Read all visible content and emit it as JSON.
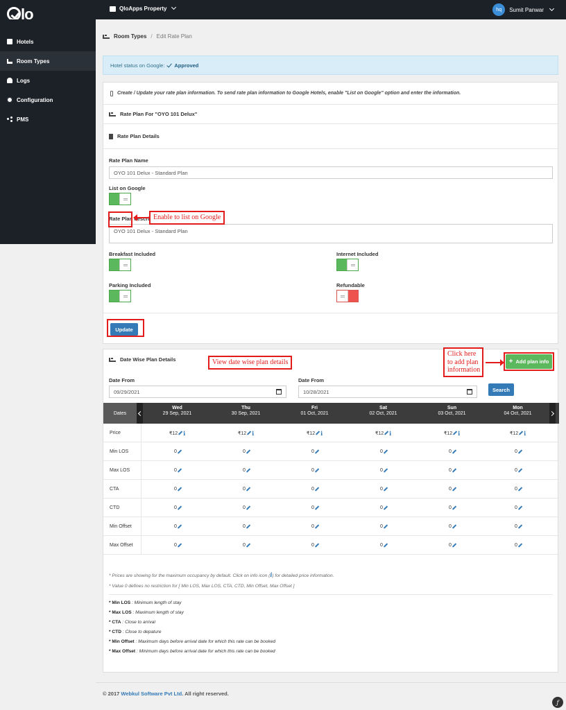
{
  "app": {
    "logo": "Qlo"
  },
  "header": {
    "property": "QloApps Property",
    "user_initials": "hq",
    "user_name": "Sumit Panwar"
  },
  "sidebar": {
    "items": [
      {
        "label": "Hotels",
        "icon": "hotel-icon"
      },
      {
        "label": "Room Types",
        "icon": "bed-icon",
        "active": true
      },
      {
        "label": "Logs",
        "icon": "bell-icon"
      },
      {
        "label": "Configuration",
        "icon": "gear-icon"
      },
      {
        "label": "PMS",
        "icon": "share-icon"
      }
    ]
  },
  "breadcrumb": {
    "parent": "Room Types",
    "current": "Edit Rate Plan"
  },
  "alert": {
    "text": "Hotel status on Google:",
    "status": "Approved"
  },
  "info": {
    "text": "Create / Update your rate plan information. To send rate plan information to Google Hotels, enable \"List on Google\" option and enter the information."
  },
  "rate_plan": {
    "heading": "Rate Plan For \"OYO 101 Delux\"",
    "details_heading": "Rate Plan Details",
    "name_label": "Rate Plan Name",
    "name_value": "OYO 101 Delux - Standard Plan",
    "list_on_google_label": "List on Google",
    "list_on_google": true,
    "description_label": "Rate Plan description",
    "description_value": "OYO 101 Delux - Standard Plan",
    "breakfast_label": "Breakfast Included",
    "breakfast": true,
    "internet_label": "Internet Included",
    "internet": true,
    "parking_label": "Parking Included",
    "parking": true,
    "refundable_label": "Refundable",
    "refundable": false,
    "update_label": "Update"
  },
  "callouts": {
    "google": "Enable to list on Google",
    "datewise": "View date wise plan details",
    "add_plan": "Click here to add plan information"
  },
  "date_wise": {
    "heading": "Date Wise Plan Details",
    "add_label": "Add plan info",
    "from_label_1": "Date From",
    "from_value_1": "09/29/2021",
    "from_label_2": "Date From",
    "from_value_2": "10/28/2021",
    "search_label": "Search",
    "dates_label": "Dates",
    "days": [
      {
        "name": "Wed",
        "date": "29 Sep, 2021"
      },
      {
        "name": "Thu",
        "date": "30 Sep, 2021"
      },
      {
        "name": "Fri",
        "date": "01 Oct, 2021"
      },
      {
        "name": "Sat",
        "date": "02 Oct, 2021"
      },
      {
        "name": "Sun",
        "date": "03 Oct, 2021"
      },
      {
        "name": "Mon",
        "date": "04 Oct, 2021"
      }
    ],
    "rows": [
      {
        "label": "Price",
        "value": "₹12",
        "has_info": true
      },
      {
        "label": "Min LOS",
        "value": "0"
      },
      {
        "label": "Max LOS",
        "value": "0"
      },
      {
        "label": "CTA",
        "value": "0"
      },
      {
        "label": "CTD",
        "value": "0"
      },
      {
        "label": "Min Offset",
        "value": "0"
      },
      {
        "label": "Max Offset",
        "value": "0"
      }
    ]
  },
  "notes": {
    "n1_before": "* Prices are showing for the maximum occupancy by default. Click on info icon (",
    "n1_icon": "i",
    "n1_after": ") for detailed price information.",
    "n2": "* Value 0 defines no restriction for [ Min LOS, Max LOS, CTA, CTD, Min Offset, Max Offset ]",
    "legend": [
      {
        "term": "* Min LOS",
        "desc": " : Minimum length of stay"
      },
      {
        "term": "* Max LOS",
        "desc": " : Maximum length of stay"
      },
      {
        "term": "* CTA",
        "desc": " : Close to arrival"
      },
      {
        "term": "* CTD",
        "desc": " : Close to depature"
      },
      {
        "term": "* Min Offset",
        "desc": " : Maximum days before arrival date for which this rate can be booked"
      },
      {
        "term": "* Max Offset",
        "desc": " : Minimum days before arrival date for which this rate can be booked"
      }
    ]
  },
  "footer": {
    "prefix": "© 2017 ",
    "brand": "Webkul Software Pvt Ltd",
    "suffix": ". All right reserved."
  },
  "badge": {
    "symbol": "ƒ"
  }
}
